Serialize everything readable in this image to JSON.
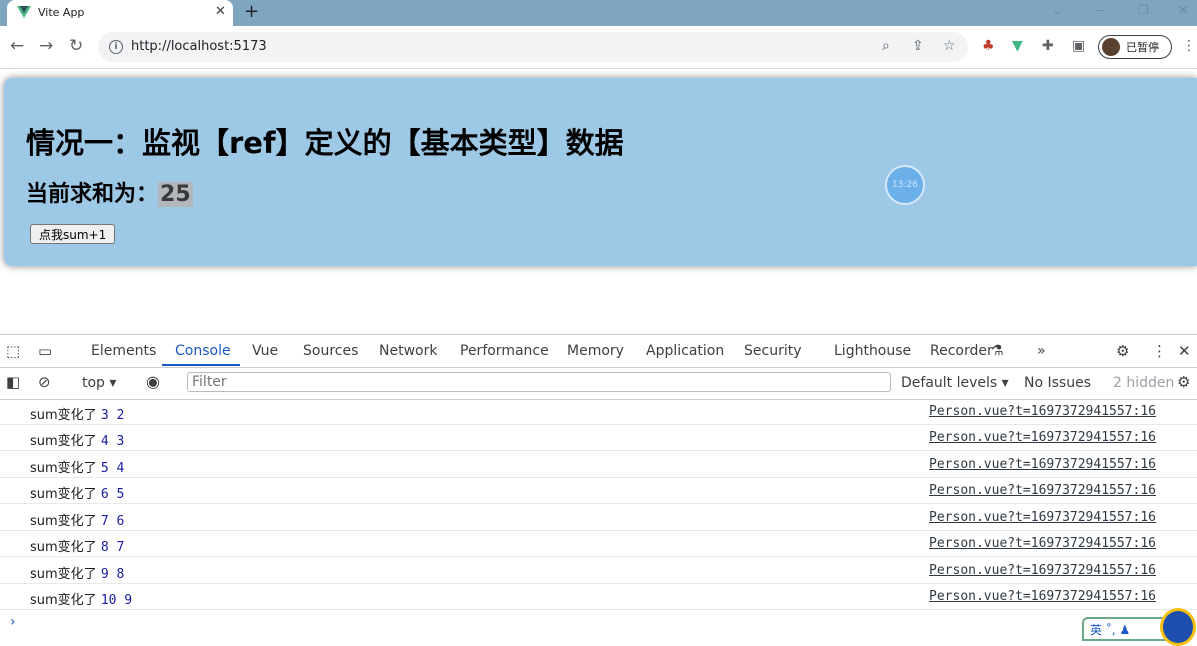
{
  "browser": {
    "tab_title": "Vite App",
    "tab_close": "✕",
    "new_tab": "+",
    "url": "http://localhost:5173",
    "profile_label": "已暂停",
    "window_controls": [
      "⌄",
      "—",
      "❐",
      "✕"
    ]
  },
  "page": {
    "heading": "情况一：监视【ref】定义的【基本类型】数据",
    "sum_label": "当前求和为：",
    "sum_value": "25",
    "button_label": "点我sum+1",
    "timer_text": "13:26"
  },
  "devtools": {
    "tabs": [
      "Elements",
      "Console",
      "Vue",
      "Sources",
      "Network",
      "Performance",
      "Memory",
      "Application",
      "Security",
      "Lighthouse",
      "Recorder"
    ],
    "active_tab": "Console",
    "more_tabs": "»",
    "context": "top",
    "filter_placeholder": "Filter",
    "log_levels": "Default levels ▾",
    "issues": "No Issues",
    "hidden": "2 hidden",
    "console_rows": [
      {
        "label": "sum变化了",
        "values": "3 2",
        "source": "Person.vue?t=1697372941557:16"
      },
      {
        "label": "sum变化了",
        "values": "4 3",
        "source": "Person.vue?t=1697372941557:16"
      },
      {
        "label": "sum变化了",
        "values": "5 4",
        "source": "Person.vue?t=1697372941557:16"
      },
      {
        "label": "sum变化了",
        "values": "6 5",
        "source": "Person.vue?t=1697372941557:16"
      },
      {
        "label": "sum变化了",
        "values": "7 6",
        "source": "Person.vue?t=1697372941557:16"
      },
      {
        "label": "sum变化了",
        "values": "8 7",
        "source": "Person.vue?t=1697372941557:16"
      },
      {
        "label": "sum变化了",
        "values": "9 8",
        "source": "Person.vue?t=1697372941557:16"
      },
      {
        "label": "sum变化了",
        "values": "10 9",
        "source": "Person.vue?t=1697372941557:16"
      }
    ],
    "prompt": "›"
  },
  "ime": {
    "label": "英 ˚, ♟"
  },
  "colors": {
    "vue_green": "#41b883",
    "active_tab": "#1a57c7",
    "page_bg": "#9dc8e6"
  }
}
